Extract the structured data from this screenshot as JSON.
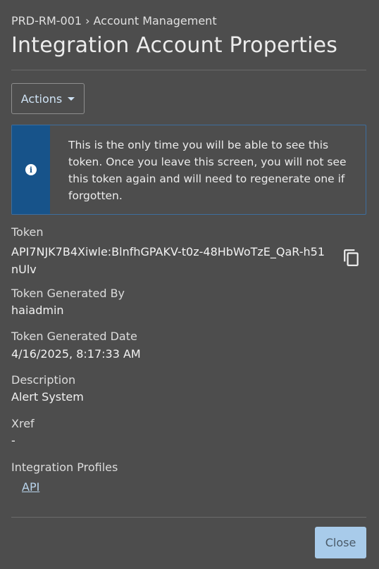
{
  "header": {
    "breadcrumb": {
      "parent": "PRD-RM-001",
      "separator": "›",
      "current": "Account Management"
    },
    "title": "Integration Account Properties"
  },
  "toolbar": {
    "actions_label": "Actions"
  },
  "alert": {
    "icon": "info-icon",
    "message": "This is the only time you will be able to see this token. Once you leave this screen, you will not see this token again and will need to regenerate one if forgotten."
  },
  "fields": {
    "token": {
      "label": "Token",
      "value": "API7NJK7B4Xiwle:BlnfhGPAKV-t0z-48HbWoTzE_QaR-h51nUlv",
      "copy_icon": "copy-icon"
    },
    "generated_by": {
      "label": "Token Generated By",
      "value": "haiadmin"
    },
    "generated_date": {
      "label": "Token Generated Date",
      "value": "4/16/2025, 8:17:33 AM"
    },
    "description": {
      "label": "Description",
      "value": "Alert System"
    },
    "xref": {
      "label": "Xref",
      "value": "-"
    },
    "integration_profiles": {
      "label": "Integration Profiles",
      "items": [
        "API"
      ]
    }
  },
  "footer": {
    "close_label": "Close"
  },
  "colors": {
    "background": "#4d4d4d",
    "alert_accent": "#17538a",
    "alert_border": "#3d6e9e",
    "link": "#b9d4ec",
    "primary_button": "#a8cbea"
  }
}
